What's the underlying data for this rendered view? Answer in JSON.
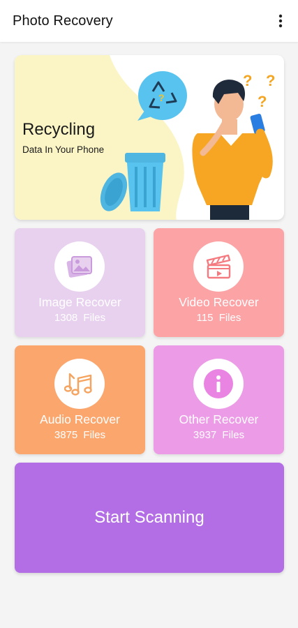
{
  "app": {
    "title": "Photo Recovery",
    "menu_icon": "more-vertical-icon"
  },
  "banner": {
    "title": "Recycling",
    "subtitle": "Data In Your Phone"
  },
  "cards": [
    {
      "label": "Image Recover",
      "count": "1308 Files",
      "icon": "image-icon",
      "color": "#e8d1ef"
    },
    {
      "label": "Video Recover",
      "count": "115 Files",
      "icon": "clapperboard-icon",
      "color": "#fca3a6"
    },
    {
      "label": "Audio Recover",
      "count": "3875 Files",
      "icon": "music-note-icon",
      "color": "#fba66d"
    },
    {
      "label": "Other Recover",
      "count": "3937 Files",
      "icon": "info-icon",
      "color": "#ec9be6"
    }
  ],
  "scan_button": {
    "label": "Start Scanning",
    "color": "#b36ee6"
  }
}
